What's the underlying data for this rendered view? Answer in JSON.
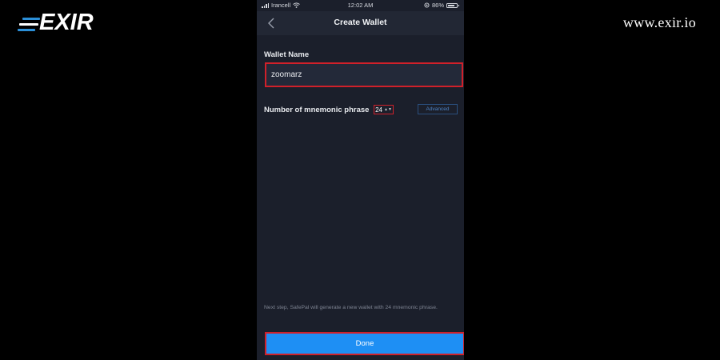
{
  "brand": {
    "logo_text": "EXIR",
    "url": "www.exir.io",
    "logo_accent_color": "#2b8fd8"
  },
  "status_bar": {
    "carrier": "Irancell",
    "time": "12:02 AM",
    "battery": "86%",
    "battery_level": 0.86
  },
  "nav": {
    "back_icon": "chevron-left-icon",
    "title": "Create Wallet"
  },
  "form": {
    "wallet_name_label": "Wallet Name",
    "wallet_name_value": "zoomarz",
    "mnemonic_label": "Number of mnemonic phrase",
    "mnemonic_value": "24",
    "advanced_label": "Advanced"
  },
  "hint": "Next step, SafePal will generate a new wallet with 24 mnemonic phrase.",
  "done_label": "Done",
  "colors": {
    "highlight": "#d0202a",
    "primary_button": "#1e8ff4",
    "background": "#1b1f2b"
  }
}
